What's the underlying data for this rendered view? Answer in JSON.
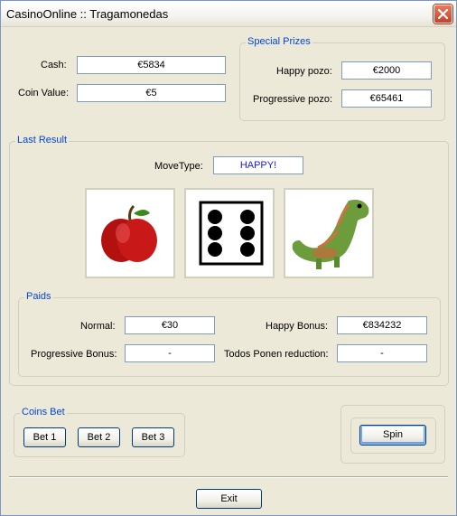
{
  "window": {
    "title": "CasinoOnline :: Tragamonedas"
  },
  "account": {
    "cash_label": "Cash:",
    "cash_value": "€5834",
    "coin_label": "Coin Value:",
    "coin_value": "€5"
  },
  "special_prizes": {
    "legend": "Special Prizes",
    "happy_label": "Happy pozo:",
    "happy_value": "€2000",
    "progressive_label": "Progressive pozo:",
    "progressive_value": "€65461"
  },
  "last_result": {
    "legend": "Last Result",
    "movetype_label": "MoveType:",
    "movetype_value": "HAPPY!",
    "reels": [
      "apple",
      "dice-six",
      "dinosaur"
    ]
  },
  "paids": {
    "legend": "Paids",
    "normal_label": "Normal:",
    "normal_value": "€30",
    "happy_bonus_label": "Happy Bonus:",
    "happy_bonus_value": "€834232",
    "progressive_bonus_label": "Progressive Bonus:",
    "progressive_bonus_value": "-",
    "todos_label": "Todos Ponen reduction:",
    "todos_value": "-"
  },
  "coins_bet": {
    "legend": "Coins Bet",
    "bet1": "Bet 1",
    "bet2": "Bet 2",
    "bet3": "Bet 3"
  },
  "actions": {
    "spin": "Spin",
    "exit": "Exit"
  },
  "colors": {
    "legend_text": "#0046d5",
    "movetype_text": "#1a1ae0",
    "window_bg": "#ece9d8"
  }
}
